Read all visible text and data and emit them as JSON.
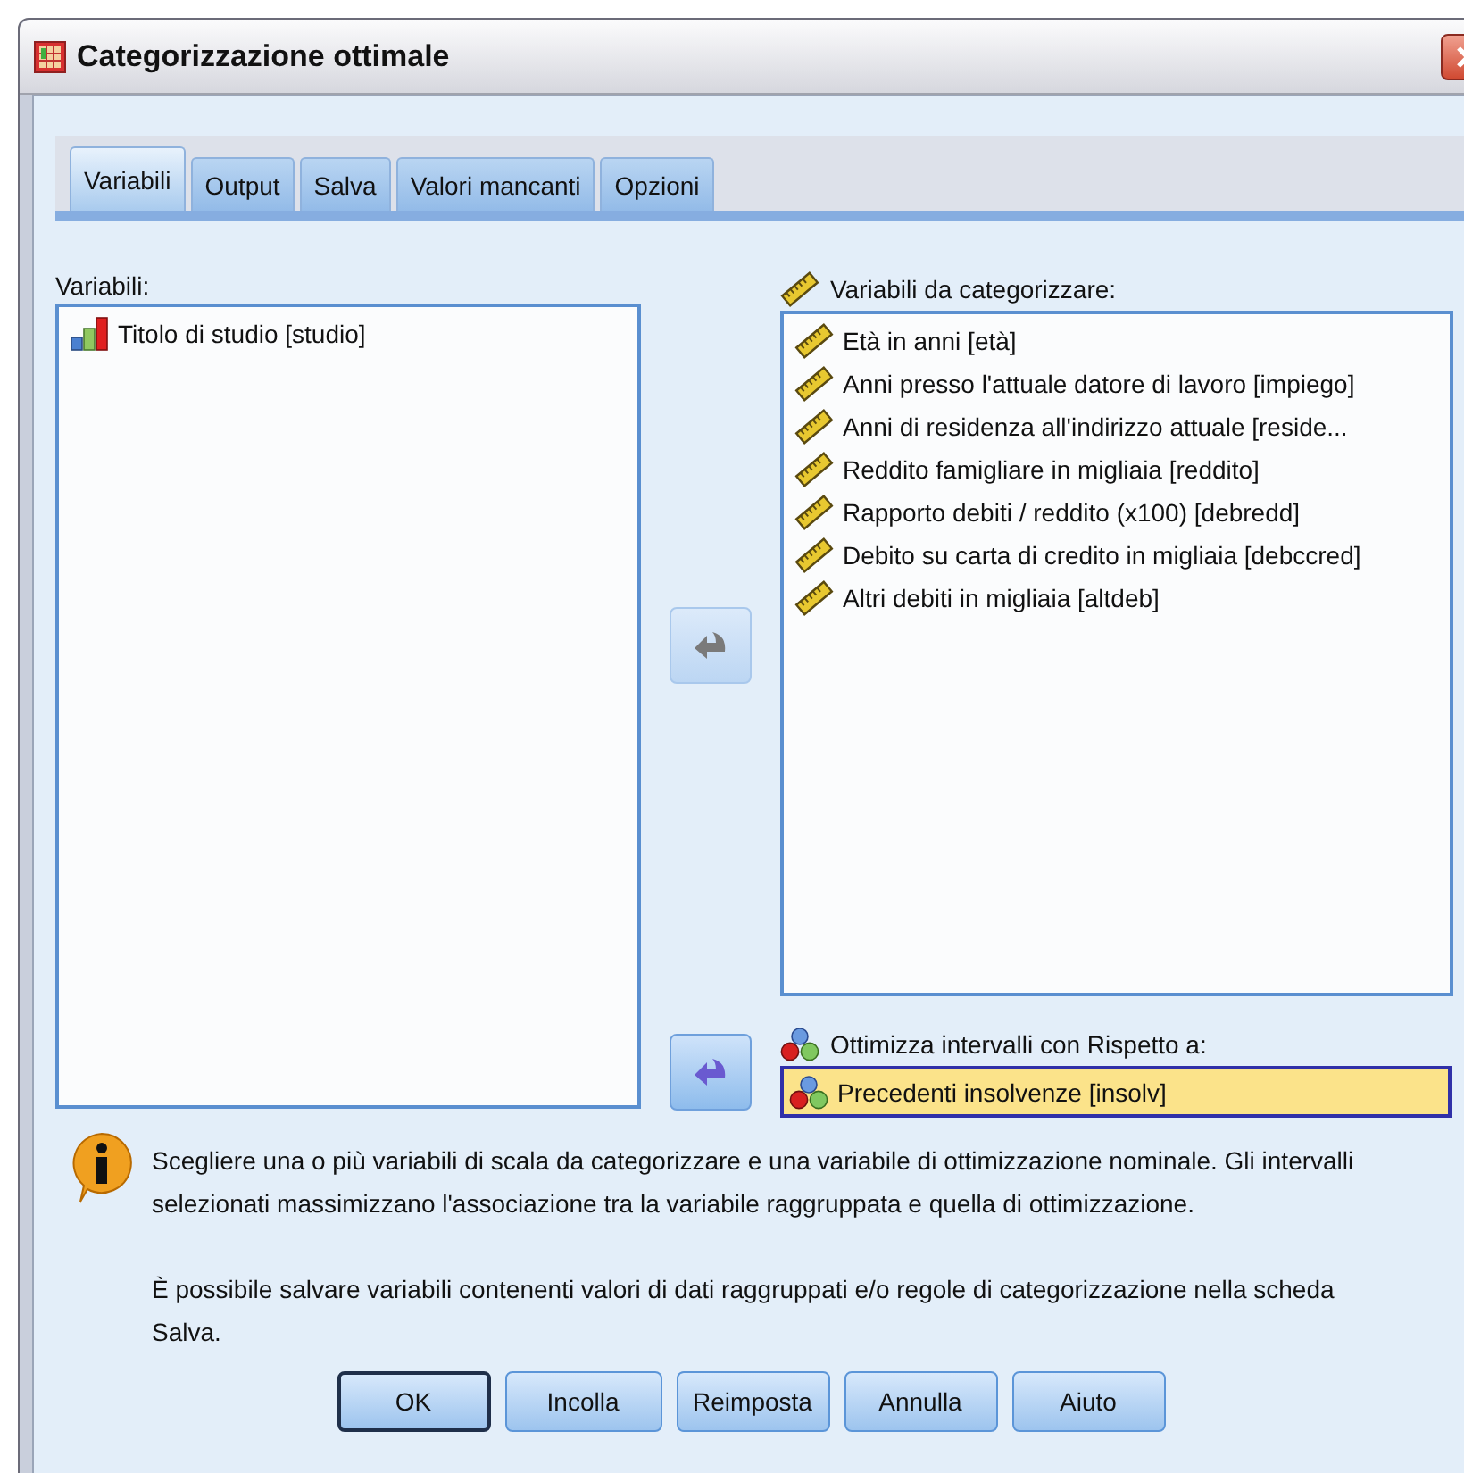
{
  "window": {
    "title": "Categorizzazione ottimale"
  },
  "tabs": [
    {
      "label": "Variabili",
      "selected": true
    },
    {
      "label": "Output",
      "selected": false
    },
    {
      "label": "Salva",
      "selected": false
    },
    {
      "label": "Valori mancanti",
      "selected": false
    },
    {
      "label": "Opzioni",
      "selected": false
    }
  ],
  "source": {
    "label": "Variabili:",
    "items": [
      {
        "kind": "ordinal",
        "label": "Titolo di studio [studio]"
      }
    ]
  },
  "move_buttons": [
    {
      "disabled": true
    },
    {
      "disabled": false
    }
  ],
  "target_list": {
    "label": "Variabili da categorizzare:",
    "items": [
      {
        "kind": "scale",
        "label": "Età in anni [età]"
      },
      {
        "kind": "scale",
        "label": "Anni presso l'attuale datore di lavoro [impiego]"
      },
      {
        "kind": "scale",
        "label": "Anni di residenza all'indirizzo attuale [reside..."
      },
      {
        "kind": "scale",
        "label": "Reddito famigliare in migliaia [reddito]"
      },
      {
        "kind": "scale",
        "label": "Rapporto debiti / reddito (x100) [debredd]"
      },
      {
        "kind": "scale",
        "label": "Debito su carta di credito in migliaia [debccred]"
      },
      {
        "kind": "scale",
        "label": "Altri debiti in migliaia [altdeb]"
      }
    ]
  },
  "optimize": {
    "label": "Ottimizza intervalli con Rispetto a:",
    "item": {
      "kind": "nominal",
      "label": "Precedenti insolvenze [insolv]",
      "selected": true
    }
  },
  "info": {
    "paragraphs": [
      "Scegliere una o più variabili di scala da categorizzare e una variabile di ottimizzazione nominale. Gli intervalli selezionati massimizzano l'associazione tra la variabile raggruppata e quella di ottimizzazione.",
      "È possibile salvare variabili contenenti valori di dati raggruppati e/o regole di categorizzazione nella scheda Salva."
    ]
  },
  "buttons": [
    {
      "label": "OK",
      "default": true
    },
    {
      "label": "Incolla",
      "default": false
    },
    {
      "label": "Reimposta",
      "default": false
    },
    {
      "label": "Annulla",
      "default": false
    },
    {
      "label": "Aiuto",
      "default": false
    }
  ]
}
